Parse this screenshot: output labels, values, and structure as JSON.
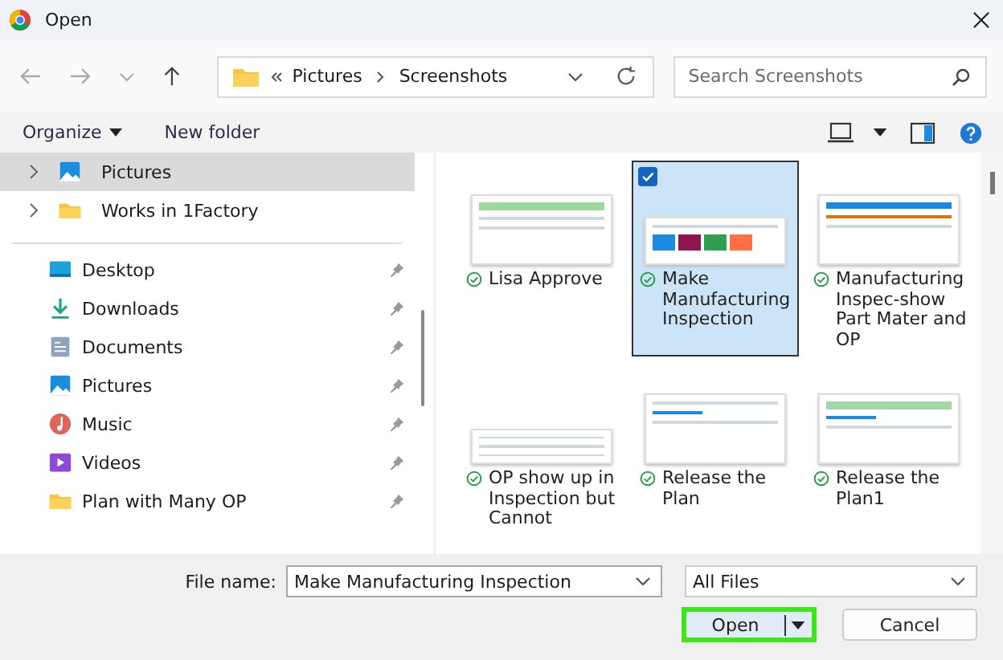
{
  "window": {
    "title": "Open"
  },
  "address_bar": {
    "path": [
      "Pictures",
      "Screenshots"
    ]
  },
  "search": {
    "placeholder": "Search Screenshots"
  },
  "toolbar": {
    "organize": "Organize",
    "new_folder": "New folder"
  },
  "tree": [
    {
      "label": "Pictures",
      "kind": "pictures",
      "selected": true
    },
    {
      "label": "Works in 1Factory",
      "kind": "folder",
      "selected": false
    }
  ],
  "quick_access": [
    {
      "label": "Desktop",
      "kind": "desktop",
      "pinned": true
    },
    {
      "label": "Downloads",
      "kind": "downloads",
      "pinned": true
    },
    {
      "label": "Documents",
      "kind": "documents",
      "pinned": true
    },
    {
      "label": "Pictures",
      "kind": "pictures",
      "pinned": true
    },
    {
      "label": "Music",
      "kind": "music",
      "pinned": true
    },
    {
      "label": "Videos",
      "kind": "videos",
      "pinned": true
    },
    {
      "label": "Plan with Many OP",
      "kind": "folder",
      "pinned": true
    }
  ],
  "files": [
    {
      "name": "Lisa Approve",
      "selected": false,
      "synced": true
    },
    {
      "name": "Make Manufacturing Inspection",
      "selected": true,
      "synced": true
    },
    {
      "name": "Manufacturing Inspec-show Part Mater and OP",
      "selected": false,
      "synced": true
    },
    {
      "name": "OP show up in Inspection but Cannot",
      "selected": false,
      "synced": true
    },
    {
      "name": "Release the Plan",
      "selected": false,
      "synced": true
    },
    {
      "name": "Release the Plan1",
      "selected": false,
      "synced": true
    }
  ],
  "file_name": {
    "label": "File name:",
    "value": "Make Manufacturing Inspection"
  },
  "file_type": {
    "value": "All Files"
  },
  "buttons": [
    {
      "label": "Open",
      "kind": "primary",
      "highlighted": true
    },
    {
      "label": "Cancel",
      "kind": "secondary",
      "highlighted": false
    }
  ]
}
